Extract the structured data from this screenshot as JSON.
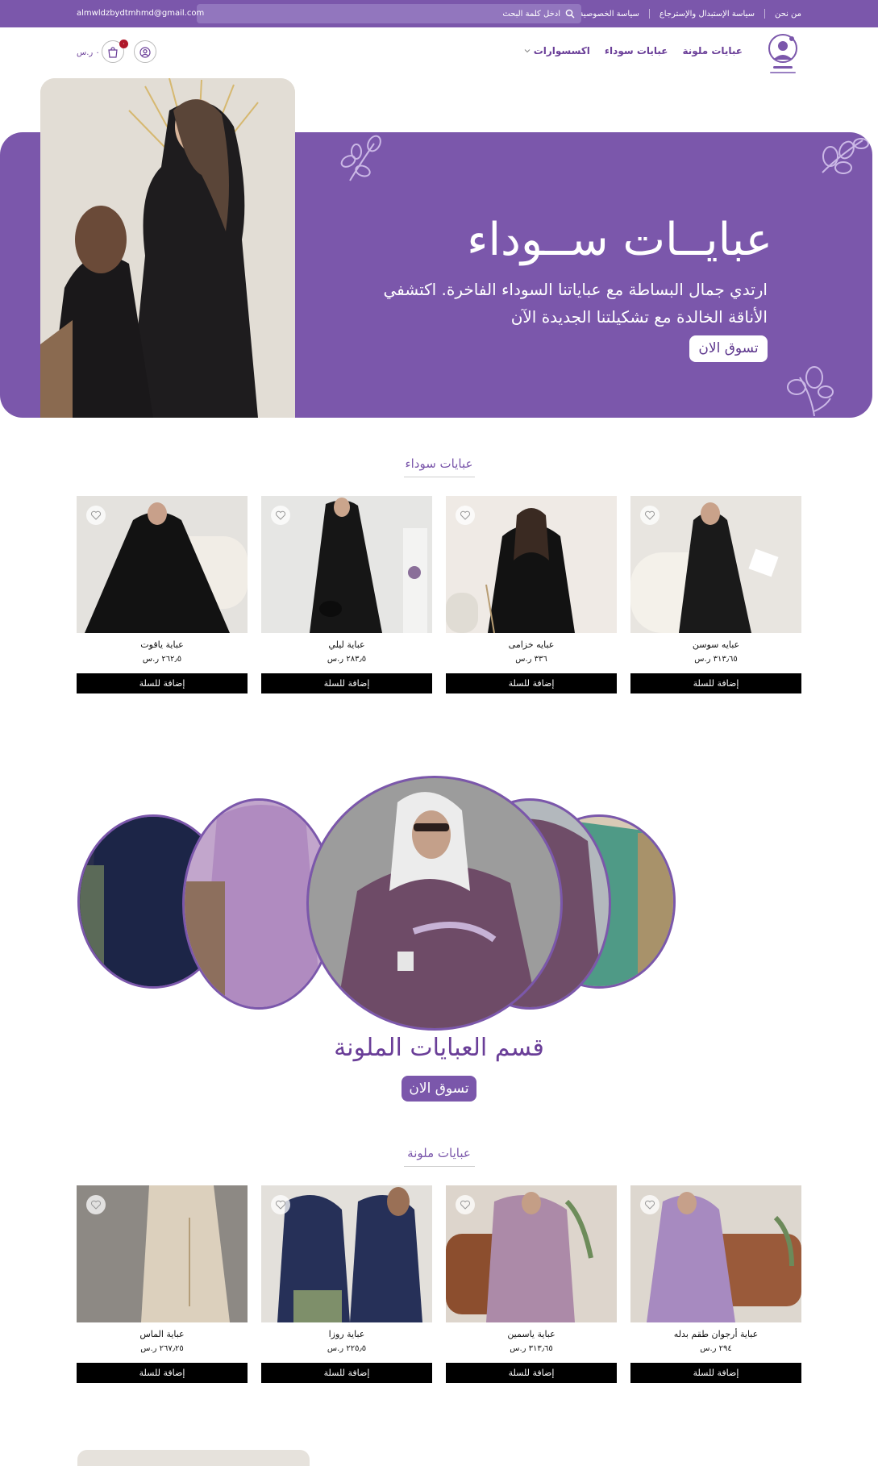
{
  "topbar": {
    "links": [
      "من نحن",
      "سياسة الإستبدال والإسترجاع",
      "سياسة الخصوصية"
    ],
    "search_placeholder": "ادخل كلمة البحث",
    "email": "almwldzbydtmhmd@gmail.com"
  },
  "nav": {
    "items": [
      "عبايات ملونة",
      "عبايات سوداء",
      "اكسسوارات"
    ],
    "cart_count": "٠",
    "cart_total": "٠ ر.س"
  },
  "hero": {
    "title": "عبايــات ســوداء",
    "subtitle": "ارتدي جمال البساطة مع عباياتنا السوداء الفاخرة. اكتشفي الأناقة الخالدة مع تشكيلتنا الجديدة الآن",
    "button": "تسوق الان"
  },
  "black_section": {
    "title": "عبايات سوداء",
    "products": [
      {
        "name": "عبايه سوسن",
        "price": "٣١٣٫٦٥ ر.س",
        "button": "إضافة للسلة"
      },
      {
        "name": "عبايه خزامى",
        "price": "٣٣٦ ر.س",
        "button": "إضافة للسلة"
      },
      {
        "name": "عباية ليلي",
        "price": "٢٨٣٫٥ ر.س",
        "button": "إضافة للسلة"
      },
      {
        "name": "عباية ياقوت",
        "price": "٢٦٢٫٥ ر.س",
        "button": "إضافة للسلة"
      }
    ]
  },
  "colored_banner": {
    "title": "قسم العبايات الملونة",
    "button": "تسوق الان"
  },
  "colored_section": {
    "title": "عبايات ملونة",
    "products": [
      {
        "name": "عباية أرجوان طقم بدله",
        "price": "٢٩٤ ر.س",
        "button": "إضافة للسلة"
      },
      {
        "name": "عباية ياسمين",
        "price": "٣١٣٫٦٥ ر.س",
        "button": "إضافة للسلة"
      },
      {
        "name": "عباية روزا",
        "price": "٢٢٥٫٥ ر.س",
        "button": "إضافة للسلة"
      },
      {
        "name": "عباية الماس",
        "price": "٢٦٧٫٢٥ ر.س",
        "button": "إضافة للسلة"
      }
    ]
  },
  "colors": {
    "brand_purple": "#7b57ab",
    "dark_purple": "#6a3e98",
    "button_black": "#000000",
    "badge_red": "#b0182a"
  },
  "icons": [
    "search-icon",
    "user-icon",
    "cart-icon",
    "heart-icon",
    "chevron-down-icon",
    "flower-icon"
  ]
}
